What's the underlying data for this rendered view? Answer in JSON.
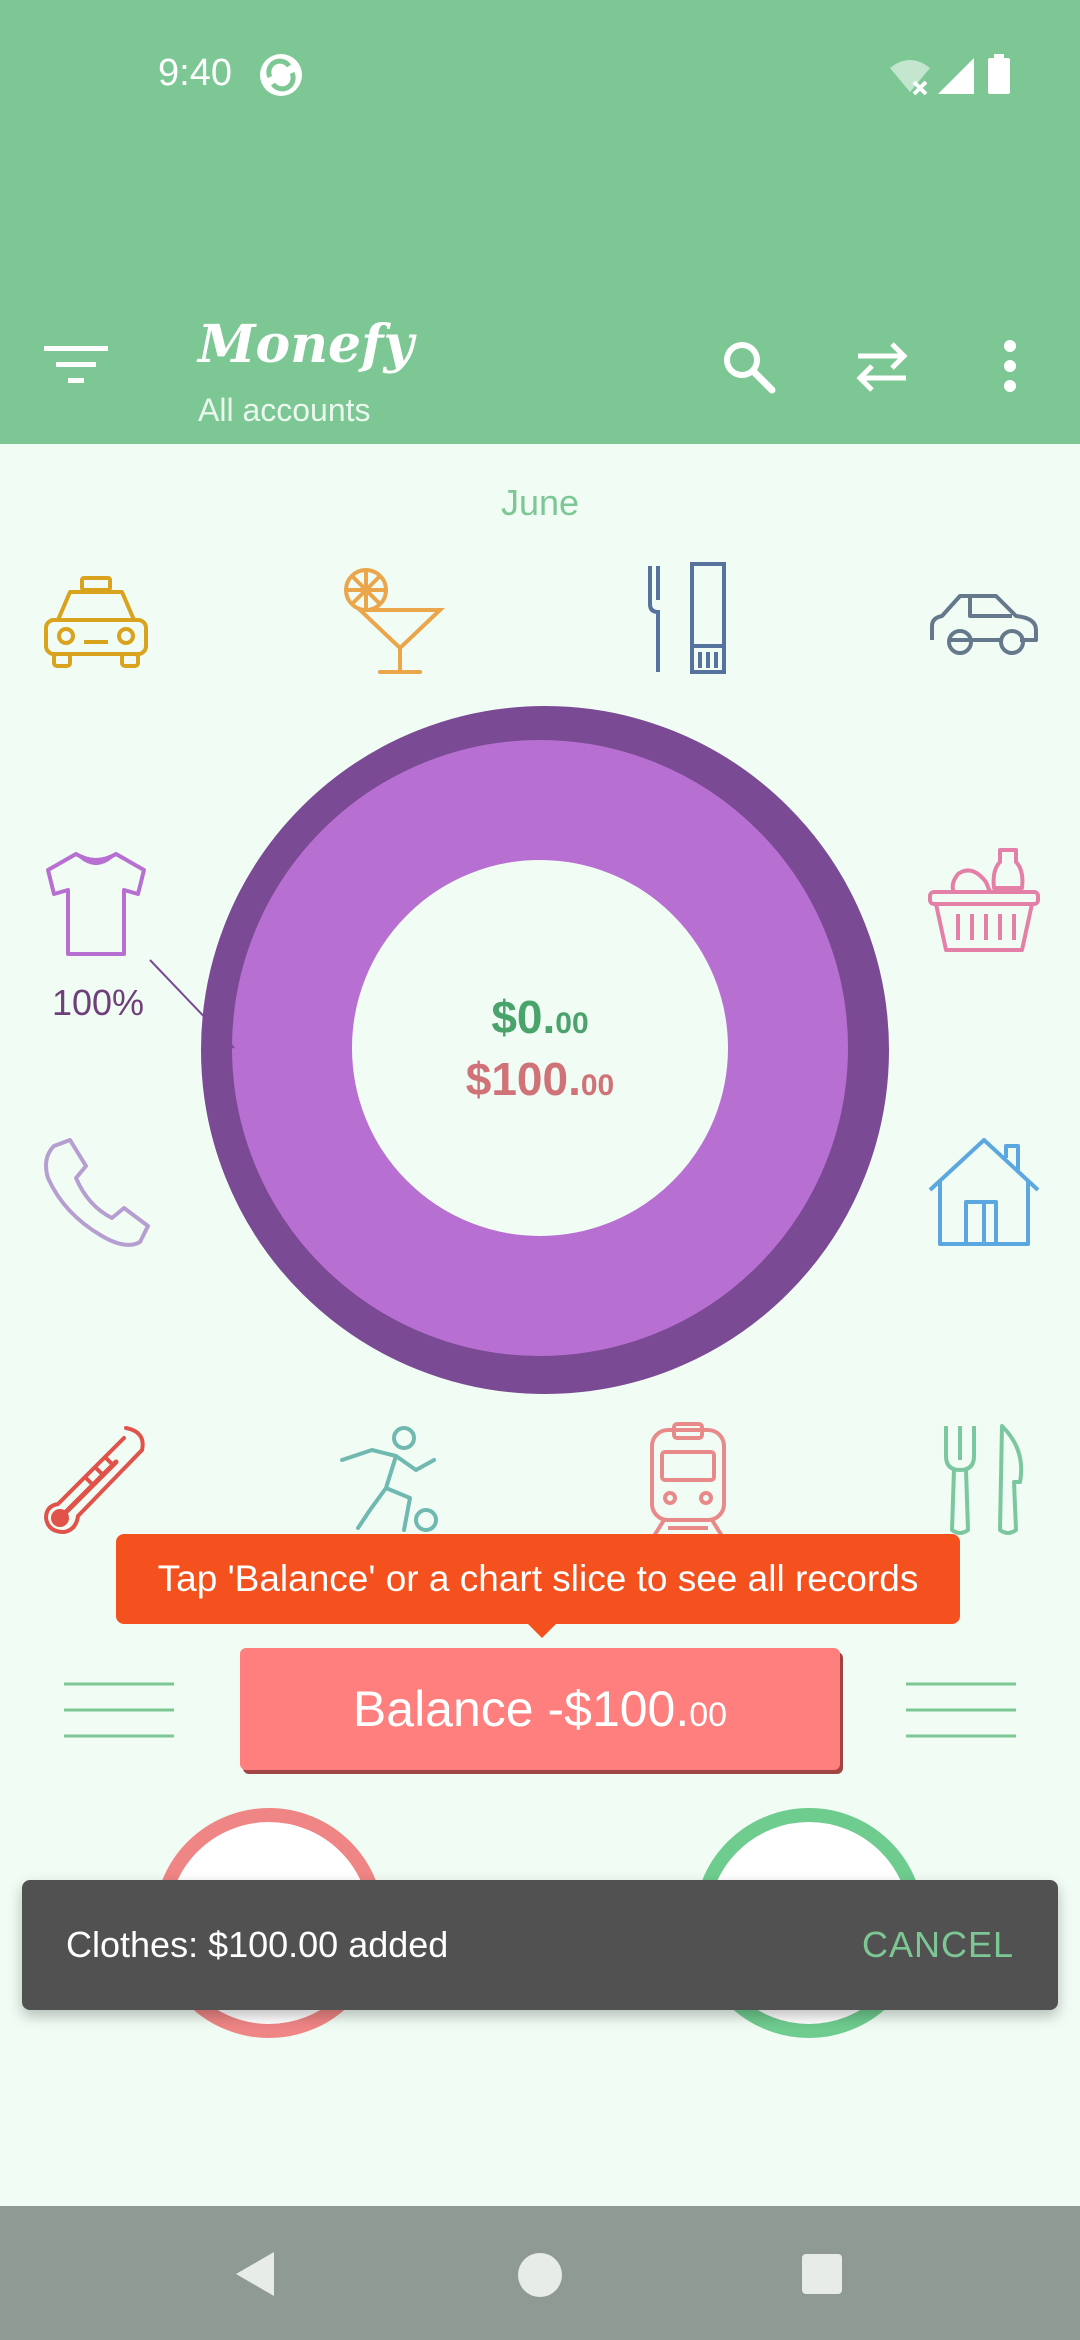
{
  "status_bar": {
    "time": "9:40",
    "icons": [
      "sync-icon",
      "wifi-off-icon",
      "signal-icon",
      "battery-icon"
    ]
  },
  "toolbar": {
    "title": "Monefy",
    "subtitle": "All accounts",
    "icons": [
      "filter-icon",
      "search-icon",
      "transfer-icon",
      "more-vert-icon"
    ],
    "background_color": "#7cc794"
  },
  "period": {
    "label": "June"
  },
  "categories": [
    {
      "name": "Taxi",
      "icon": "taxi-icon",
      "color": "#d9a31e"
    },
    {
      "name": "Drinks",
      "icon": "cocktail-icon",
      "color": "#eba54a"
    },
    {
      "name": "Toiletry",
      "icon": "toiletries-icon",
      "color": "#55739d"
    },
    {
      "name": "Car",
      "icon": "car-icon",
      "color": "#66788c"
    },
    {
      "name": "Clothes",
      "icon": "tshirt-icon",
      "color": "#b86fd2"
    },
    {
      "name": "Food",
      "icon": "grocery-basket-icon",
      "color": "#e480a8"
    },
    {
      "name": "Communications",
      "icon": "phone-icon",
      "color": "#b69ed0"
    },
    {
      "name": "House",
      "icon": "house-icon",
      "color": "#5ca7e0"
    },
    {
      "name": "Health",
      "icon": "thermometer-icon",
      "color": "#e0524a"
    },
    {
      "name": "Sports",
      "icon": "soccer-player-icon",
      "color": "#6fb9b0"
    },
    {
      "name": "Transport",
      "icon": "train-icon",
      "color": "#e88a8a"
    },
    {
      "name": "Eating out",
      "icon": "fork-knife-icon",
      "color": "#7cc7a0"
    }
  ],
  "chart": {
    "slice_label": "100%",
    "slice_color": "#b86fd2",
    "slice_shadow_color": "#7a4a94",
    "income": {
      "whole": "$0.",
      "cents": "00"
    },
    "expense": {
      "whole": "$100.",
      "cents": "00"
    }
  },
  "chart_data": {
    "type": "pie",
    "categories": [
      "Clothes"
    ],
    "values": [
      100
    ]
  },
  "tooltip": {
    "text": "Tap 'Balance' or a chart slice to see all records"
  },
  "balance": {
    "label": "Balance -$100.",
    "cents": "00",
    "color": "#ff7f7f"
  },
  "snackbar": {
    "message": "Clothes: $100.00 added",
    "action": "CANCEL"
  },
  "navbar": {
    "icons": [
      "back-icon",
      "home-icon",
      "recents-icon"
    ]
  }
}
